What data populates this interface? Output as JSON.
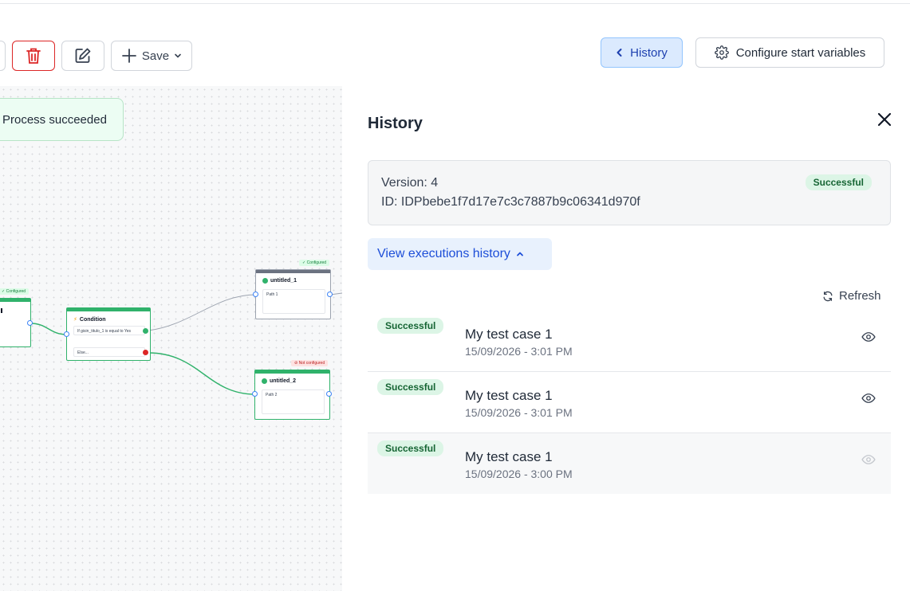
{
  "toolbar": {
    "save_label": "Save"
  },
  "header": {
    "history_label": "History",
    "configure_label": "Configure start variables"
  },
  "canvas": {
    "toast": "Process succeeded",
    "tags": {
      "configured": "Configured",
      "not_configured": "Not configured"
    },
    "condition_node": {
      "title": "Condition",
      "rule": "If gisin_titulo_1 is equal to Yes",
      "else": "Else..."
    },
    "node1": {
      "title": "untitled_1",
      "path": "Path 1"
    },
    "node2": {
      "title": "untitled_2",
      "path": "Path 2"
    }
  },
  "panel": {
    "title": "History",
    "version": "Version: 4",
    "id": "ID: IDPbebe1f7d17e7c3c7887b9c06341d970f",
    "status": "Successful",
    "view_executions": "View executions history",
    "refresh": "Refresh",
    "executions": [
      {
        "status": "Successful",
        "name": "My test case 1",
        "date": "15/09/2026 - 3:01 PM"
      },
      {
        "status": "Successful",
        "name": "My test case 1",
        "date": "15/09/2026 - 3:01 PM"
      },
      {
        "status": "Successful",
        "name": "My test case 1",
        "date": "15/09/2026 - 3:00 PM"
      }
    ]
  },
  "colors": {
    "accent": "#1d4ed8",
    "success": "#30b26b",
    "danger": "#dc2626"
  }
}
